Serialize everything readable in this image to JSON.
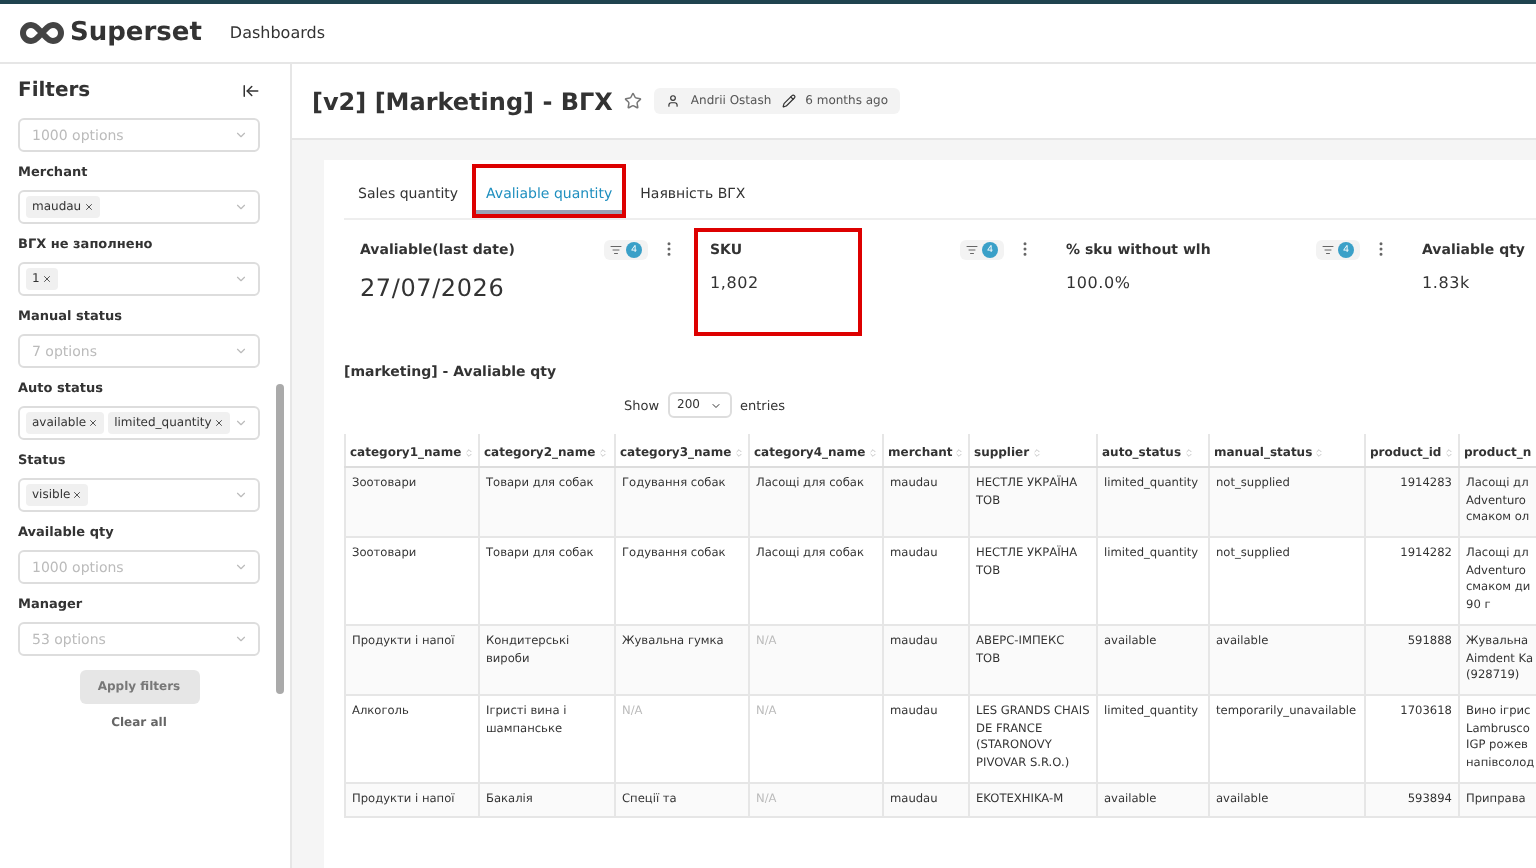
{
  "nav": {
    "brand": "Superset",
    "links": [
      "Dashboards"
    ]
  },
  "sidebar": {
    "title": "Filters",
    "filters": [
      {
        "placeholder": "1000 options"
      },
      {
        "label": "Merchant",
        "tags": [
          "maudau"
        ]
      },
      {
        "label": "ВГХ не заполнено",
        "tags": [
          "1"
        ]
      },
      {
        "label": "Manual status",
        "placeholder": "7 options"
      },
      {
        "label": "Auto status",
        "tags": [
          "available",
          "limited_quantity"
        ]
      },
      {
        "label": "Status",
        "tags": [
          "visible"
        ]
      },
      {
        "label": "Available qty",
        "placeholder": "1000 options"
      },
      {
        "label": "Manager",
        "placeholder": "53 options"
      }
    ],
    "apply": "Apply filters",
    "clear": "Clear all"
  },
  "header": {
    "title": "[v2] [Marketing] - ВГХ",
    "owner": "Andrii Ostash",
    "modified": "6 months ago"
  },
  "tabs": [
    {
      "label": "Sales quantity",
      "selected": false,
      "highlighted": false
    },
    {
      "label": "Avaliable quantity",
      "selected": true,
      "highlighted": true
    },
    {
      "label": "Наявність ВГХ",
      "selected": false,
      "highlighted": false
    }
  ],
  "kpis": [
    {
      "title": "Avaliable(last date)",
      "value": "27/07/2026",
      "filters": "4",
      "highlighted": false,
      "large": true
    },
    {
      "title": "SKU",
      "value": "1,802",
      "filters": "4",
      "highlighted": true,
      "large": false
    },
    {
      "title": "% sku without wlh",
      "value": "100.0%",
      "filters": "4",
      "highlighted": false,
      "large": false
    },
    {
      "title": "Avaliable qty",
      "value": "1.83k",
      "highlighted": false,
      "large": false
    }
  ],
  "table": {
    "title": "[marketing] - Avaliable qty",
    "show": "Show",
    "entries_value": "200",
    "entries": "entries",
    "columns": [
      "category1_name",
      "category2_name",
      "category3_name",
      "category4_name",
      "merchant",
      "supplier",
      "auto_status",
      "manual_status",
      "product_id",
      "product_n"
    ],
    "rows": [
      [
        "Зоотовари",
        "Товари для собак",
        "Годування собак",
        "Ласощі для собак",
        "maudau",
        "НЕСТЛЕ УКРАЇНА ТОВ",
        "limited_quantity",
        "not_supplied",
        "1914283",
        "Ласощі дл\nAdventuro\nсмаком ол"
      ],
      [
        "Зоотовари",
        "Товари для собак",
        "Годування собак",
        "Ласощі для собак",
        "maudau",
        "НЕСТЛЕ УКРАЇНА ТОВ",
        "limited_quantity",
        "not_supplied",
        "1914282",
        "Ласощі дл\nAdventuro\nсмаком ди\n90 г"
      ],
      [
        "Продукти і напої",
        "Кондитерські вироби",
        "Жувальна гумка",
        "N/A",
        "maudau",
        "АВЕРС-ІМПЕКС ТОВ",
        "available",
        "available",
        "591888",
        "Жувальна\nAimdent Ka\n(928719)"
      ],
      [
        "Алкоголь",
        "Ігристі вина і шампанське",
        "N/A",
        "N/A",
        "maudau",
        "LES GRANDS CHAIS DE FRANCE (STARONOVY PIVOVAR S.R.O.)",
        "limited_quantity",
        "temporarily_unavailable",
        "1703618",
        "Вино ігрис\nLambrusco\nIGP рожев\nнапівсолод"
      ],
      [
        "Продукти і напої",
        "Бакалія",
        "Спеції та",
        "N/A",
        "maudau",
        "EKOTEXHIKA-M",
        "available",
        "available",
        "593894",
        "Приправа"
      ]
    ]
  }
}
